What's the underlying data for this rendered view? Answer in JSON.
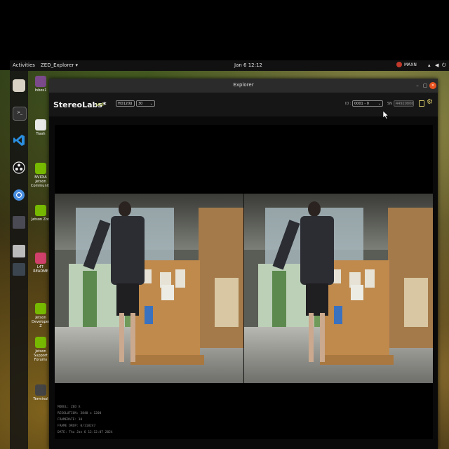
{
  "topbar": {
    "activities": "Activities",
    "app_menu": "ZED_Explorer ▾",
    "clock": "Jan 6  12:12",
    "power_mode": "MAXN"
  },
  "desktop": {
    "icons": [
      {
        "label": "Inbox1"
      },
      {
        "label": "Trash"
      },
      {
        "label": "NVIDIA Jetson Community"
      },
      {
        "label": "Jetson Zoo"
      },
      {
        "label": "L4T-README"
      },
      {
        "label": "Jetson Developer Z"
      },
      {
        "label": "Jetson Support Forums"
      },
      {
        "label": "Terminal"
      }
    ]
  },
  "window": {
    "title": "Explorer",
    "minimize": "–",
    "maximize": "▢",
    "close": "✕"
  },
  "toolbar": {
    "logo": "StereoLabs*",
    "live_label": "LIVE",
    "resolution": "HD1200",
    "fps": "30",
    "id_label": "ID :",
    "camera_id": "0001 - 0",
    "sn_label": "SN :",
    "serial": "44920806"
  },
  "info": {
    "model": "MODEL: ZED X",
    "resolution": "RESOLUTION: 3840 x 1200",
    "framerate": "FRAMERATE: 30",
    "frame_drop": "FRAME DROP: 0/118247",
    "date": "DATE: Thu Jan 6 12:12:07 2024"
  },
  "colors": {
    "live": "#c6d94a",
    "window_bg": "#0a0a0a",
    "titlebar": "#2b2b2b",
    "close_button": "#e95420"
  }
}
